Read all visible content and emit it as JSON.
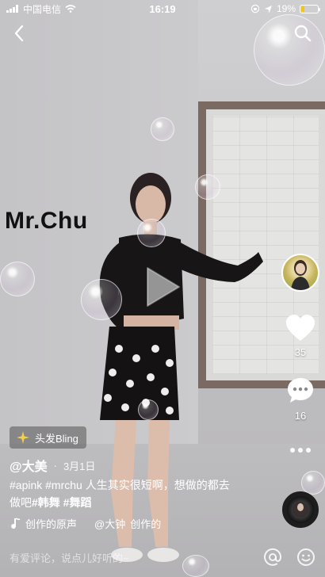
{
  "status_bar": {
    "carrier": "中国电信",
    "time": "16:19",
    "battery": "19%",
    "battery_level": 0.19
  },
  "video": {
    "overlay_text": "Mr.Chu"
  },
  "right_rail": {
    "likes": "35",
    "comments": "16"
  },
  "tag": {
    "label": "头发Bling"
  },
  "post": {
    "author": "@大美",
    "date": "3月1日",
    "desc_line1": "#apink #mrchu 人生其实很短啊，想做的都去",
    "desc_line2_plain": "做吧",
    "desc_line2_tags": "#韩舞 #舞蹈"
  },
  "music": {
    "title": "创作的原声",
    "author": "@大钟",
    "trailing": "创作的"
  },
  "comment_bar": {
    "placeholder": "有爱评论，说点儿好听的~"
  },
  "colors": {
    "battery_fill": "#f5c518",
    "heart_fill": "#ffffff"
  }
}
